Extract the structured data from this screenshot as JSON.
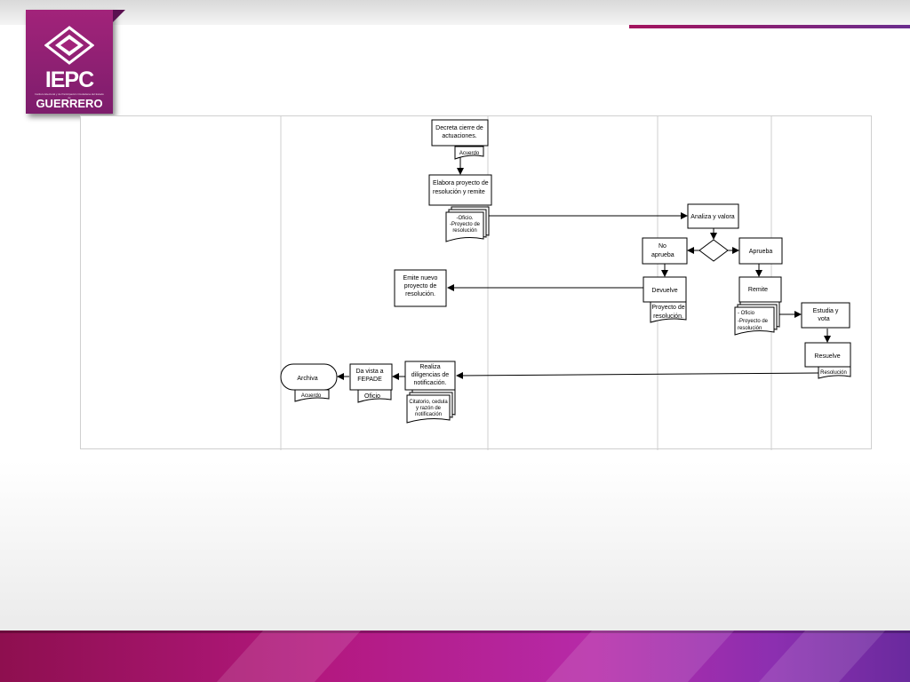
{
  "logo": {
    "acronym": "IEPC",
    "subtitle": "Instituto Electoral y de Participación Ciudadana del Estado de",
    "state": "GUERRERO",
    "colors": {
      "primary": "#a2237a",
      "dark": "#7d1d6c"
    }
  },
  "theme": {
    "accent_gradient": [
      "#a3145e",
      "#6b2e8e"
    ],
    "bottom_gradient": [
      "#8e0f4f",
      "#b3187f",
      "#b62aa8",
      "#6a2a9e"
    ]
  },
  "flowchart": {
    "nodes": {
      "decreta": [
        "Decreta cierre de",
        "actuaciones."
      ],
      "acuerdo_doc": "Acuerdo",
      "elabora": [
        "Elabora proyecto de",
        "resolución y remite"
      ],
      "oficio_doc": [
        "-Oficio.",
        "-Proyecto de",
        "resolución"
      ],
      "analiza": "Analiza y valora",
      "no_aprueba": [
        "No",
        "aprueba"
      ],
      "aprueba": "Aprueba",
      "devuelve": "Devuelve",
      "devuelve_doc": [
        "Proyecto de",
        "resolución."
      ],
      "emite": [
        "Emite nuevo",
        "proyecto de",
        "resolución."
      ],
      "remite": "Remite",
      "remite_doc": [
        "- Oficio",
        "-Proyecto de",
        "resolución"
      ],
      "estudia": [
        "Estudia y",
        "vota"
      ],
      "resuelve": "Resuelve",
      "resolucion_doc": "Resolución",
      "realiza": [
        "Realiza",
        "diligencias de",
        "notificación."
      ],
      "realiza_doc": [
        "Citatorio, cedula",
        "y razón de",
        "notificación"
      ],
      "da_vista": [
        "Da vista a",
        "FEPADE"
      ],
      "oficio_single": "Oficio",
      "archiva": "Archiva",
      "acuerdo_doc2": "Acuerdo"
    }
  }
}
